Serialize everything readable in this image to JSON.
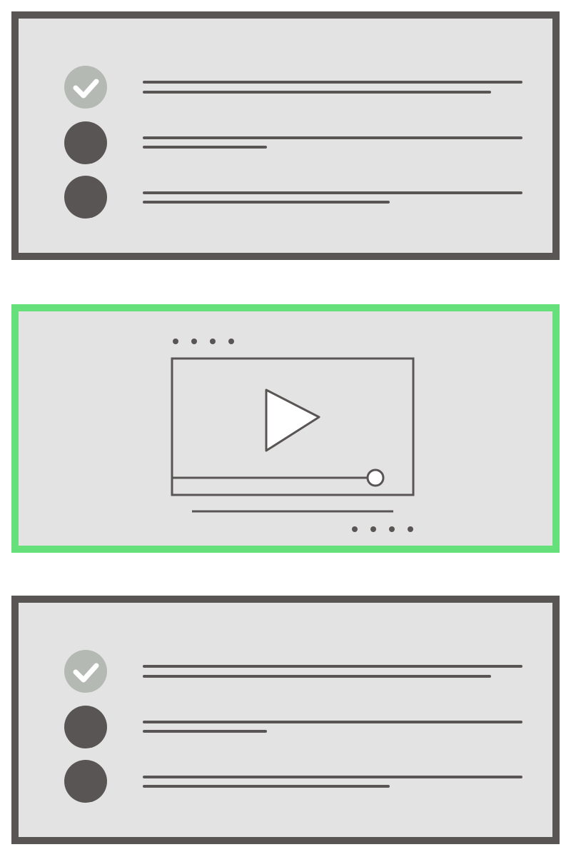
{
  "colors": {
    "background": "#ffffff",
    "panel_fill": "#e3e3e3",
    "panel_border": "#5a5555",
    "accent_border": "#66e07a",
    "stroke": "#5a5555",
    "completed_circle": "#b4b9b3",
    "checkmark": "#ffffff",
    "pending_circle": "#5a5555"
  },
  "panels": [
    {
      "kind": "checklist",
      "border_color": "#5a5555",
      "items": [
        {
          "status": "completed",
          "icon": "check-icon"
        },
        {
          "status": "pending",
          "icon": "filled-circle-icon"
        },
        {
          "status": "pending",
          "icon": "filled-circle-icon"
        }
      ]
    },
    {
      "kind": "video",
      "border_color": "#66e07a",
      "icons": [
        "play-icon",
        "progress-knob-icon"
      ],
      "progress": 0.86
    },
    {
      "kind": "checklist",
      "border_color": "#5a5555",
      "items": [
        {
          "status": "completed",
          "icon": "check-icon"
        },
        {
          "status": "pending",
          "icon": "filled-circle-icon"
        },
        {
          "status": "pending",
          "icon": "filled-circle-icon"
        }
      ]
    }
  ]
}
